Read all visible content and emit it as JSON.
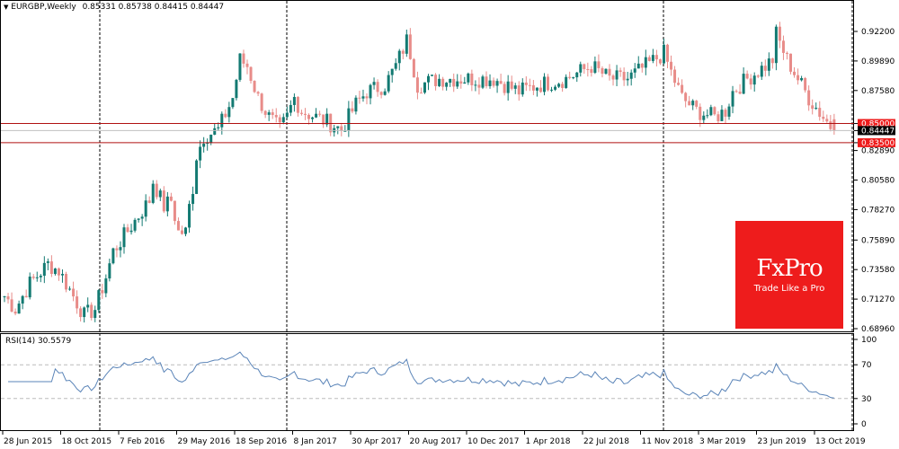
{
  "header": {
    "symbol_label": "EURGBP,Weekly",
    "ohlc": "0.85331 0.85738 0.84415 0.84447",
    "menu_icon": "triangle-down-icon"
  },
  "logo": {
    "brand": "FxPro",
    "tagline": "Trade Like a Pro",
    "color": "#ee1c1c"
  },
  "colors": {
    "bull": "#137a72",
    "bear": "#e88c89",
    "level_line": "#b01010",
    "bid_line": "#c0c0c0",
    "rsi_line": "#5a84b8"
  },
  "chart_data": {
    "type": "candlestick",
    "symbol": "EURGBP",
    "timeframe": "Weekly",
    "y_ticks": [
      "0.92200",
      "0.89890",
      "0.87580",
      "0.85000",
      "0.84447",
      "0.83500",
      "0.82890",
      "0.80580",
      "0.78270",
      "0.75890",
      "0.73580",
      "0.71270",
      "0.68960"
    ],
    "ylim": [
      0.6896,
      0.922
    ],
    "levels": [
      {
        "value": 0.85,
        "label": "0.85000"
      },
      {
        "value": 0.835,
        "label": "0.83500"
      }
    ],
    "last_price": {
      "value": 0.84447,
      "label": "0.84447"
    },
    "x_ticks": [
      "28 Jun 2015",
      "18 Oct 2015",
      "7 Feb 2016",
      "29 May 2016",
      "18 Sep 2016",
      "8 Jan 2017",
      "30 Apr 2017",
      "20 Aug 2017",
      "10 Dec 2017",
      "1 Apr 2018",
      "22 Jul 2018",
      "11 Nov 2018",
      "3 Mar 2019",
      "23 Jun 2019",
      "13 Oct 2019"
    ],
    "close_path": [
      [
        0,
        0.715
      ],
      [
        3,
        0.705
      ],
      [
        7,
        0.725
      ],
      [
        12,
        0.74
      ],
      [
        15,
        0.735
      ],
      [
        19,
        0.715
      ],
      [
        22,
        0.7
      ],
      [
        25,
        0.705
      ],
      [
        28,
        0.73
      ],
      [
        30,
        0.75
      ],
      [
        35,
        0.77
      ],
      [
        40,
        0.79
      ],
      [
        41,
        0.805
      ],
      [
        44,
        0.785
      ],
      [
        46,
        0.79
      ],
      [
        48,
        0.765
      ],
      [
        50,
        0.765
      ],
      [
        51,
        0.785
      ],
      [
        52,
        0.8
      ],
      [
        53,
        0.825
      ],
      [
        55,
        0.84
      ],
      [
        59,
        0.845
      ],
      [
        63,
        0.87
      ],
      [
        65,
        0.9
      ],
      [
        67,
        0.895
      ],
      [
        70,
        0.87
      ],
      [
        73,
        0.855
      ],
      [
        76,
        0.845
      ],
      [
        78,
        0.855
      ],
      [
        80,
        0.87
      ],
      [
        82,
        0.86
      ],
      [
        86,
        0.855
      ],
      [
        90,
        0.85
      ],
      [
        93,
        0.845
      ],
      [
        97,
        0.865
      ],
      [
        100,
        0.875
      ],
      [
        105,
        0.88
      ],
      [
        108,
        0.895
      ],
      [
        111,
        0.915
      ],
      [
        112,
        0.905
      ],
      [
        114,
        0.88
      ],
      [
        120,
        0.885
      ],
      [
        127,
        0.885
      ],
      [
        135,
        0.885
      ],
      [
        142,
        0.875
      ],
      [
        147,
        0.88
      ],
      [
        155,
        0.885
      ],
      [
        162,
        0.895
      ],
      [
        167,
        0.885
      ],
      [
        172,
        0.885
      ],
      [
        177,
        0.895
      ],
      [
        182,
        0.905
      ],
      [
        184,
        0.89
      ],
      [
        187,
        0.87
      ],
      [
        191,
        0.86
      ],
      [
        196,
        0.855
      ],
      [
        199,
        0.86
      ],
      [
        201,
        0.875
      ],
      [
        205,
        0.885
      ],
      [
        210,
        0.895
      ],
      [
        212,
        0.9
      ],
      [
        213,
        0.92
      ],
      [
        216,
        0.9
      ],
      [
        219,
        0.885
      ],
      [
        222,
        0.87
      ],
      [
        226,
        0.855
      ],
      [
        229,
        0.8445
      ]
    ],
    "rsi": {
      "label": "RSI(14) 30.5579",
      "period": 14,
      "last": 30.5579,
      "levels": [
        70,
        30
      ],
      "y_ticks": [
        "100",
        "70",
        "30",
        "0"
      ],
      "ylim": [
        0,
        100
      ]
    }
  }
}
